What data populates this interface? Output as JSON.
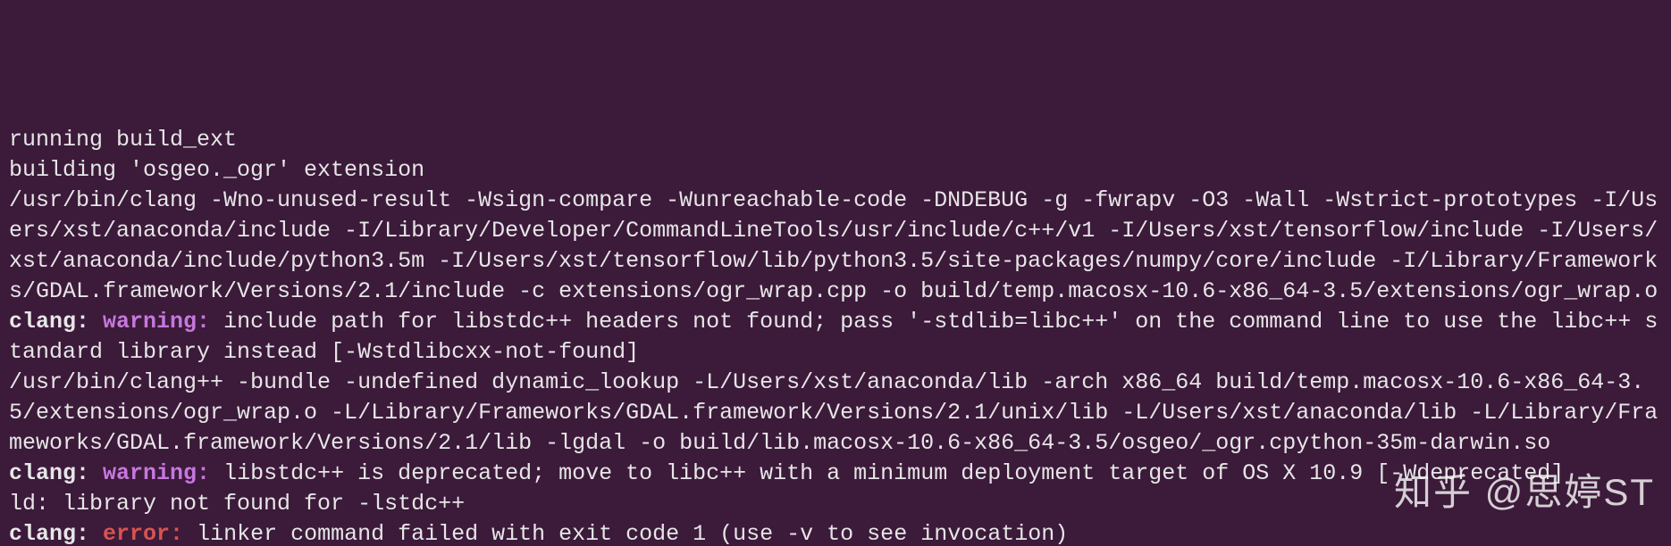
{
  "terminal": {
    "lines": [
      {
        "segments": [
          {
            "text": "running build_ext"
          }
        ]
      },
      {
        "segments": [
          {
            "text": "building 'osgeo._ogr' extension"
          }
        ]
      },
      {
        "segments": [
          {
            "text": "/usr/bin/clang -Wno-unused-result -Wsign-compare -Wunreachable-code -DNDEBUG -g -fwrapv -O3 -Wall -Wstrict-prototypes -I/Users/xst/anaconda/include -I/Library/Developer/CommandLineTools/usr/include/c++/v1 -I/Users/xst/tensorflow/include -I/Users/xst/anaconda/include/python3.5m -I/Users/xst/tensorflow/lib/python3.5/site-packages/numpy/core/include -I/Library/Frameworks/GDAL.framework/Versions/2.1/include -c extensions/ogr_wrap.cpp -o build/temp.macosx-10.6-x86_64-3.5/extensions/ogr_wrap.o"
          }
        ]
      },
      {
        "segments": [
          {
            "text": "clang: ",
            "cls": "clang-src"
          },
          {
            "text": "warning: ",
            "cls": "warn"
          },
          {
            "text": "include path for libstdc++ headers not found; pass '-stdlib=libc++' on the command line to use the libc++ standard library instead [-Wstdlibcxx-not-found]"
          }
        ]
      },
      {
        "segments": [
          {
            "text": "/usr/bin/clang++ -bundle -undefined dynamic_lookup -L/Users/xst/anaconda/lib -arch x86_64 build/temp.macosx-10.6-x86_64-3.5/extensions/ogr_wrap.o -L/Library/Frameworks/GDAL.framework/Versions/2.1/unix/lib -L/Users/xst/anaconda/lib -L/Library/Frameworks/GDAL.framework/Versions/2.1/lib -lgdal -o build/lib.macosx-10.6-x86_64-3.5/osgeo/_ogr.cpython-35m-darwin.so"
          }
        ]
      },
      {
        "segments": [
          {
            "text": "clang: ",
            "cls": "clang-src"
          },
          {
            "text": "warning: ",
            "cls": "warn"
          },
          {
            "text": "libstdc++ is deprecated; move to libc++ with a minimum deployment target of OS X 10.9 [-Wdeprecated]"
          }
        ]
      },
      {
        "segments": [
          {
            "text": "ld: library not found for -lstdc++"
          }
        ]
      },
      {
        "segments": [
          {
            "text": "clang: ",
            "cls": "clang-src"
          },
          {
            "text": "error: ",
            "cls": "err"
          },
          {
            "text": "linker command failed with exit code 1 (use -v to see invocation)"
          }
        ]
      }
    ]
  },
  "watermark": "知乎 @思婷ST"
}
